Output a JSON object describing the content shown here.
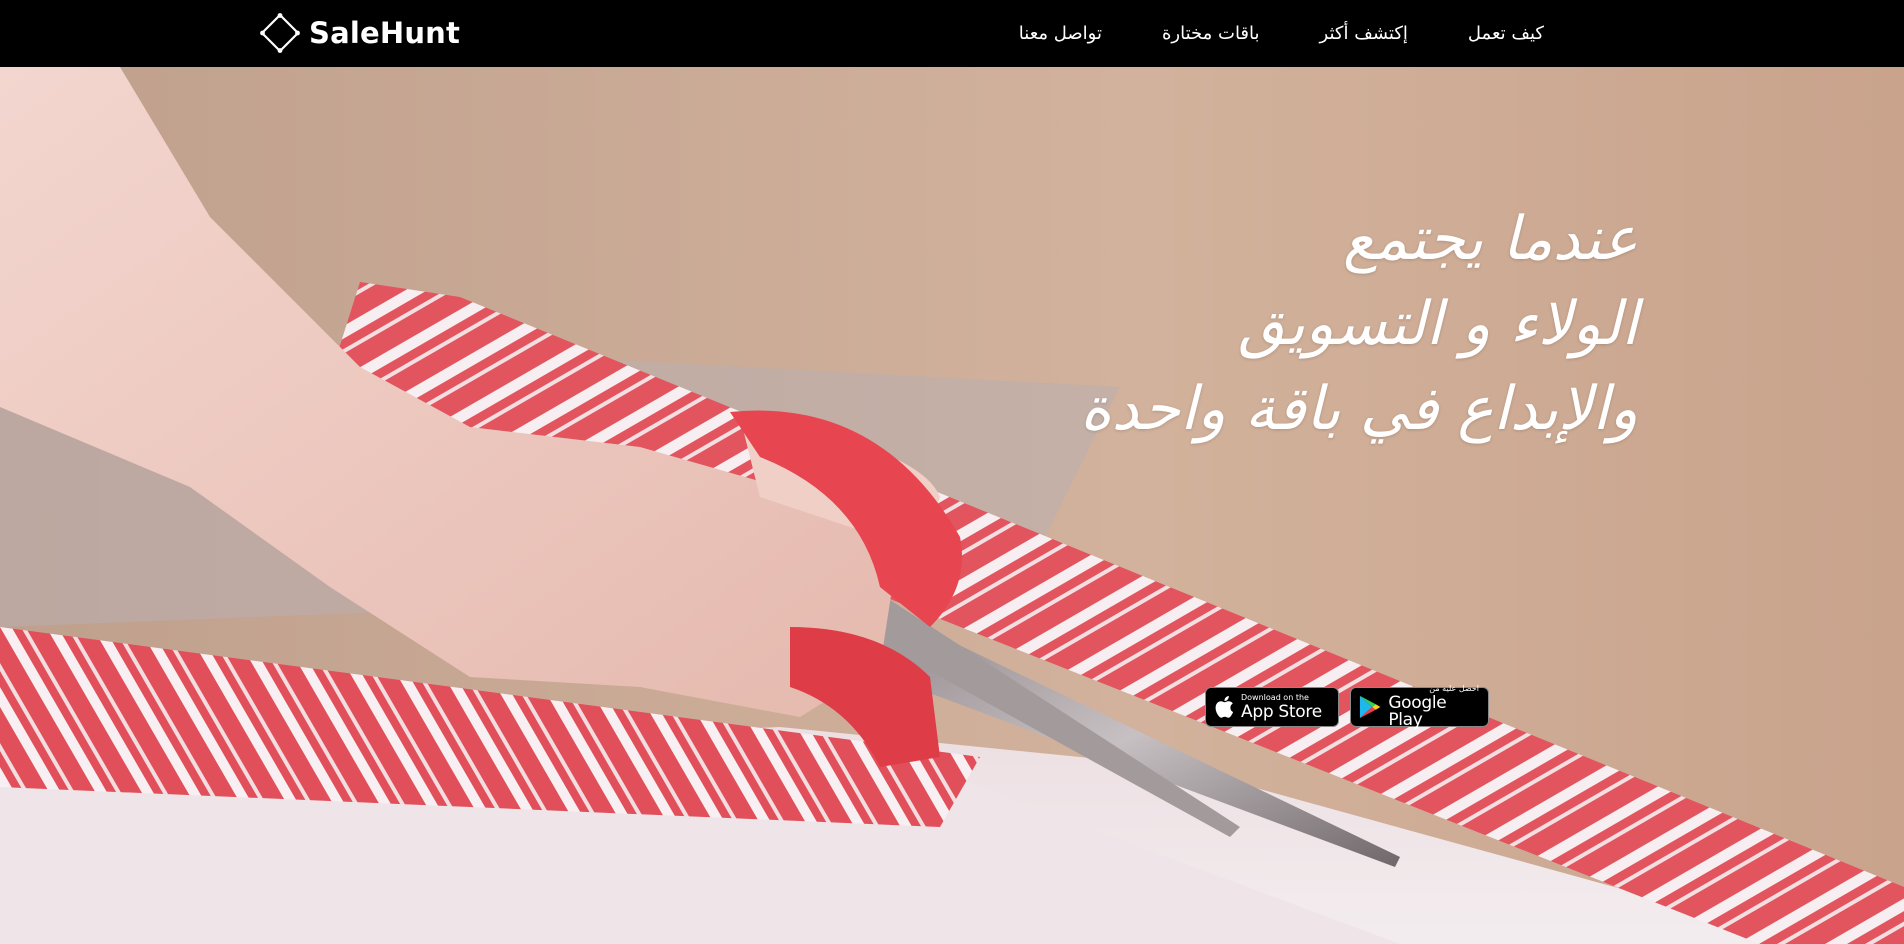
{
  "brand": {
    "name": "SaleHunt",
    "logo_icon": "diamond-logo-icon"
  },
  "nav": {
    "items": [
      {
        "label": "كيف تعمل"
      },
      {
        "label": "إكتشف أكثر"
      },
      {
        "label": "باقات مختارة"
      },
      {
        "label": "تواصل معنا"
      }
    ]
  },
  "hero": {
    "headline_lines": [
      "عندما يجتمع",
      "الولاء و التسويق",
      "والإبداع في باقة واحدة"
    ],
    "app_store": {
      "small": "Download on the",
      "big": "App Store",
      "icon": "apple-icon"
    },
    "google_play": {
      "small": "احصل عليه من",
      "big": "Google Play",
      "icon": "google-play-icon"
    }
  },
  "colors": {
    "nav_bg": "#000000",
    "nav_text": "#ffffff",
    "wrap_red": "#e2545e",
    "scissor_red": "#e7454f"
  }
}
